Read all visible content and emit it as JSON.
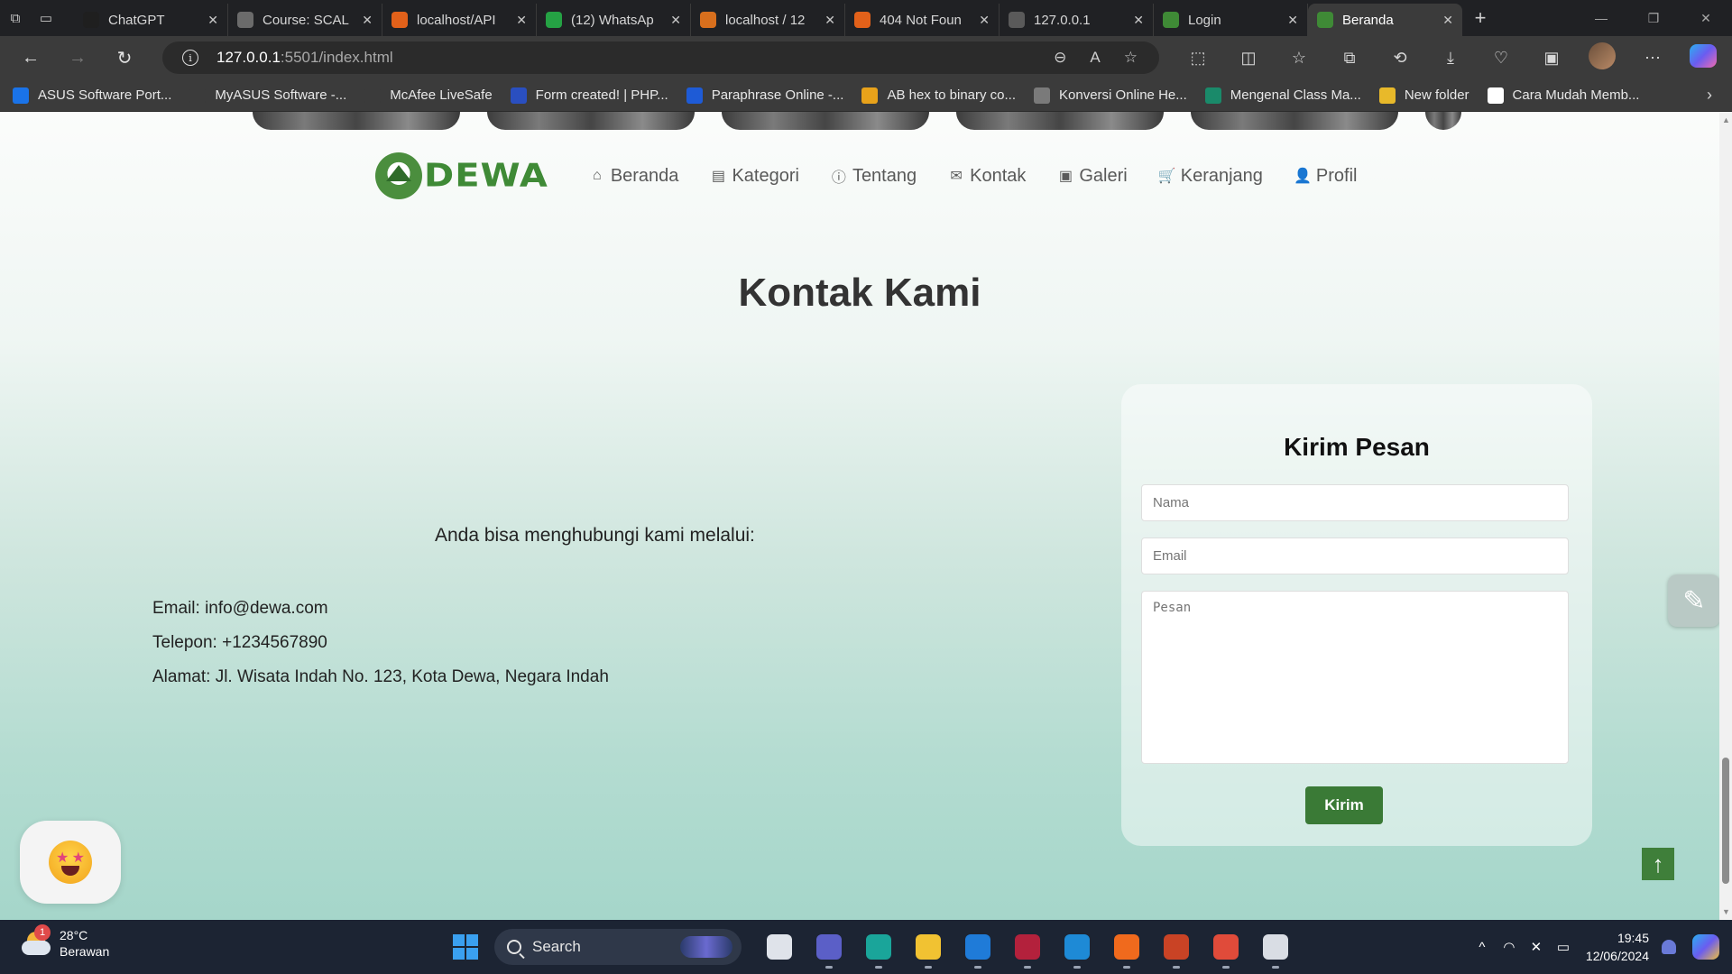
{
  "browser": {
    "tabs": [
      {
        "title": "ChatGPT",
        "icon": "chatgpt-icon",
        "color": "#1f1f1f"
      },
      {
        "title": "Course: SCAL",
        "icon": "course-icon",
        "color": "#6b6b6b"
      },
      {
        "title": "localhost/API",
        "icon": "xampp-icon",
        "color": "#e2611a"
      },
      {
        "title": "(12) WhatsAp",
        "icon": "whatsapp-icon",
        "color": "#25a244"
      },
      {
        "title": "localhost / 12",
        "icon": "phpmyadmin-icon",
        "color": "#d86f1d"
      },
      {
        "title": "404 Not Foun",
        "icon": "xampp-icon",
        "color": "#e2611a"
      },
      {
        "title": "127.0.0.1",
        "icon": "page-icon",
        "color": "#5a5a5a"
      },
      {
        "title": "Login",
        "icon": "dewa-icon",
        "color": "#3f8a36"
      },
      {
        "title": "Beranda",
        "icon": "dewa-icon",
        "color": "#3f8a36",
        "active": true
      }
    ],
    "url_host": "127.0.0.1",
    "url_path": ":5501/index.html",
    "bookmarks": [
      {
        "label": "ASUS Software Port...",
        "icon": "asus-icon",
        "color": "#1a73e8"
      },
      {
        "label": "MyASUS Software -...",
        "icon": "page-icon",
        "color": "#3b3b3b"
      },
      {
        "label": "McAfee LiveSafe",
        "icon": "page-icon",
        "color": "#3b3b3b"
      },
      {
        "label": "Form created! | PHP...",
        "icon": "form-icon",
        "color": "#2a4fc0"
      },
      {
        "label": "Paraphrase Online -...",
        "icon": "paraphrase-icon",
        "color": "#1e5bd6"
      },
      {
        "label": "AB hex to binary co...",
        "icon": "rapidtables-icon",
        "color": "#e8a21a"
      },
      {
        "label": "Konversi Online He...",
        "icon": "calculator-icon",
        "color": "#7a7a7a"
      },
      {
        "label": "Mengenal Class Ma...",
        "icon": "site-icon",
        "color": "#1a8a6a"
      },
      {
        "label": "New folder",
        "icon": "folder-icon",
        "color": "#e8b92a"
      },
      {
        "label": "Cara Mudah Memb...",
        "icon": "site-icon",
        "color": "#ffffff"
      }
    ]
  },
  "site": {
    "logo_text": "DEWA",
    "nav": [
      {
        "label": "Beranda",
        "icon": "home-icon",
        "glyph": "⌂"
      },
      {
        "label": "Kategori",
        "icon": "table-icon",
        "glyph": "▤"
      },
      {
        "label": "Tentang",
        "icon": "info-icon",
        "glyph": "ⓘ"
      },
      {
        "label": "Kontak",
        "icon": "envelope-icon",
        "glyph": "✉"
      },
      {
        "label": "Galeri",
        "icon": "image-icon",
        "glyph": "▣"
      },
      {
        "label": "Keranjang",
        "icon": "cart-icon",
        "glyph": "🛒"
      },
      {
        "label": "Profil",
        "icon": "user-icon",
        "glyph": "👤"
      }
    ],
    "heading": "Kontak Kami",
    "intro": "Anda bisa menghubungi kami melalui:",
    "contact": {
      "email": "Email: info@dewa.com",
      "phone": "Telepon: +1234567890",
      "address": "Alamat: Jl. Wisata Indah No. 123, Kota Dewa, Negara Indah"
    },
    "form": {
      "title": "Kirim Pesan",
      "name_placeholder": "Nama",
      "email_placeholder": "Email",
      "message_placeholder": "Pesan",
      "submit_label": "Kirim"
    }
  },
  "taskbar": {
    "temperature": "28°C",
    "weather": "Berawan",
    "weather_badge": "1",
    "search_label": "Search",
    "apps": [
      {
        "icon": "task-view-icon",
        "color": "#dfe3ea"
      },
      {
        "icon": "meet-icon",
        "color": "#5b5fc7"
      },
      {
        "icon": "edge-icon",
        "color": "#1aa59a"
      },
      {
        "icon": "file-explorer-icon",
        "color": "#f1c232"
      },
      {
        "icon": "bing-icon",
        "color": "#1f7bd8"
      },
      {
        "icon": "mendeley-icon",
        "color": "#b3213c"
      },
      {
        "icon": "vscode-icon",
        "color": "#1e8ad6"
      },
      {
        "icon": "xampp-icon",
        "color": "#f06a1d"
      },
      {
        "icon": "powerpoint-icon",
        "color": "#c94325"
      },
      {
        "icon": "chrome-icon",
        "color": "#e04b3a"
      },
      {
        "icon": "snipping-tool-icon",
        "color": "#d9dde4"
      }
    ],
    "time": "19:45",
    "date": "12/06/2024"
  }
}
